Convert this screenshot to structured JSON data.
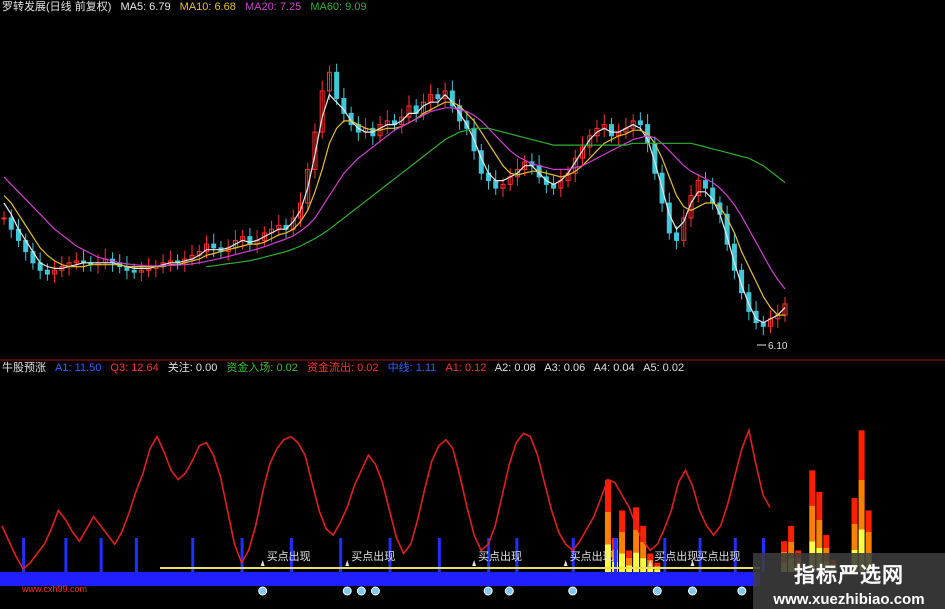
{
  "colors": {
    "background": "#000000",
    "candle_up": "#ff3030",
    "candle_down": "#40c8d8",
    "ma5": "#e8e8e8",
    "ma10": "#e8c030",
    "ma20": "#d040d0",
    "ma60": "#30b030",
    "indicator_line": "#e02020",
    "bar_bright": "#ffff40",
    "bar_mid": "#ff8000",
    "bar_deep": "#ff2000",
    "blue_band": "#2020ff",
    "signal_bar": "#2030ff",
    "yellow_line": "#e8e060",
    "arrow_label": "#e0e0e0",
    "separator": "#a01010"
  },
  "main_header": {
    "title": "罗转发展(日线 前复权)",
    "ma5": "MA5: 6.79",
    "ma10": "MA10: 6.68",
    "ma20": "MA20: 7.25",
    "ma60": "MA60: 9.09"
  },
  "indicator_header": {
    "title": "牛股预涨",
    "item1": "A1: 11.50",
    "item2": "Q3: 12.64",
    "item3": "关注: 0.00",
    "item4": "资金入场: 0.02",
    "item5": "资金流出: 0.02",
    "item6": "中线: 1.11",
    "item7": "A1: 0.12",
    "item8": "A2: 0.08",
    "item9": "A3: 0.06",
    "item10": "A4: 0.04",
    "item11": "A5: 0.02"
  },
  "low_marker": "6.10",
  "site_label": "www.cxh99.com",
  "watermark": {
    "title": "指标严选网",
    "url": "www.xuezhibiao.com"
  },
  "chart_data": [
    {
      "type": "candlestick",
      "series_names": [
        "MA5",
        "MA10",
        "MA20",
        "MA60"
      ],
      "ylim": [
        5.8,
        14.5
      ],
      "close": [
        9.2,
        8.9,
        8.6,
        8.3,
        8.0,
        7.8,
        7.7,
        7.8,
        7.9,
        8.0,
        8.05,
        8.0,
        7.95,
        8.0,
        8.1,
        8.0,
        7.9,
        7.8,
        7.75,
        7.8,
        7.85,
        7.9,
        8.0,
        8.05,
        8.0,
        8.1,
        8.2,
        8.3,
        8.5,
        8.4,
        8.3,
        8.4,
        8.6,
        8.7,
        8.5,
        8.6,
        8.8,
        8.9,
        9.0,
        8.9,
        9.2,
        9.6,
        10.5,
        11.5,
        12.6,
        13.1,
        12.4,
        12.0,
        11.7,
        11.5,
        11.6,
        11.4,
        11.7,
        11.8,
        11.7,
        11.9,
        12.2,
        12.0,
        12.3,
        12.5,
        12.4,
        12.6,
        12.2,
        11.8,
        11.6,
        11.0,
        10.4,
        10.2,
        10.0,
        10.1,
        10.3,
        10.5,
        10.7,
        10.6,
        10.3,
        10.1,
        10.0,
        10.2,
        10.4,
        10.8,
        11.1,
        11.4,
        11.6,
        11.7,
        11.4,
        11.5,
        11.6,
        11.8,
        11.7,
        11.2,
        10.4,
        9.6,
        8.8,
        8.6,
        9.2,
        9.8,
        10.2,
        10.0,
        9.6,
        9.3,
        8.5,
        7.8,
        7.2,
        6.7,
        6.4,
        6.3,
        6.5,
        6.6,
        6.9
      ],
      "ma5": [
        9.6,
        9.3,
        8.9,
        8.6,
        8.3,
        8.0,
        7.9,
        7.85,
        7.85,
        7.9,
        7.95,
        8.0,
        8.0,
        8.0,
        8.0,
        8.0,
        7.95,
        7.9,
        7.85,
        7.85,
        7.85,
        7.9,
        7.95,
        8.0,
        8.0,
        8.05,
        8.1,
        8.2,
        8.35,
        8.35,
        8.35,
        8.4,
        8.5,
        8.6,
        8.55,
        8.6,
        8.7,
        8.8,
        8.9,
        8.9,
        9.1,
        9.4,
        10.0,
        10.9,
        11.9,
        12.5,
        12.3,
        12.1,
        11.8,
        11.6,
        11.5,
        11.5,
        11.6,
        11.7,
        11.7,
        11.8,
        12.0,
        12.0,
        12.2,
        12.3,
        12.3,
        12.5,
        12.3,
        12.0,
        11.7,
        11.3,
        10.8,
        10.4,
        10.2,
        10.2,
        10.3,
        10.4,
        10.6,
        10.6,
        10.4,
        10.2,
        10.1,
        10.2,
        10.4,
        10.7,
        11.0,
        11.3,
        11.5,
        11.6,
        11.5,
        11.5,
        11.6,
        11.7,
        11.6,
        11.3,
        10.7,
        10.0,
        9.3,
        8.9,
        9.1,
        9.6,
        9.9,
        9.9,
        9.7,
        9.3,
        8.7,
        8.0,
        7.4,
        6.9,
        6.5,
        6.4,
        6.5,
        6.6,
        6.8
      ],
      "ma10": [
        9.8,
        9.6,
        9.3,
        9.0,
        8.7,
        8.4,
        8.2,
        8.05,
        7.95,
        7.9,
        7.9,
        7.9,
        7.95,
        7.95,
        7.95,
        7.95,
        7.95,
        7.9,
        7.9,
        7.9,
        7.9,
        7.9,
        7.9,
        7.95,
        7.95,
        8.0,
        8.05,
        8.1,
        8.2,
        8.25,
        8.3,
        8.35,
        8.4,
        8.45,
        8.5,
        8.5,
        8.55,
        8.65,
        8.75,
        8.8,
        8.9,
        9.1,
        9.4,
        9.9,
        10.5,
        11.2,
        11.6,
        11.8,
        11.8,
        11.7,
        11.6,
        11.55,
        11.55,
        11.6,
        11.6,
        11.65,
        11.75,
        11.85,
        12.0,
        12.1,
        12.2,
        12.3,
        12.3,
        12.2,
        12.0,
        11.8,
        11.5,
        11.2,
        10.9,
        10.6,
        10.4,
        10.35,
        10.4,
        10.45,
        10.45,
        10.4,
        10.35,
        10.3,
        10.35,
        10.45,
        10.6,
        10.8,
        11.0,
        11.2,
        11.3,
        11.4,
        11.45,
        11.55,
        11.55,
        11.45,
        11.2,
        10.8,
        10.3,
        9.8,
        9.5,
        9.4,
        9.5,
        9.6,
        9.6,
        9.5,
        9.2,
        8.8,
        8.3,
        7.9,
        7.5,
        7.1,
        6.8,
        6.6,
        6.6
      ],
      "ma20": [
        10.3,
        10.1,
        9.9,
        9.7,
        9.5,
        9.3,
        9.1,
        8.9,
        8.75,
        8.6,
        8.45,
        8.35,
        8.25,
        8.15,
        8.1,
        8.05,
        8.0,
        7.97,
        7.95,
        7.93,
        7.92,
        7.92,
        7.92,
        7.93,
        7.94,
        7.95,
        7.97,
        8.0,
        8.04,
        8.08,
        8.12,
        8.17,
        8.22,
        8.27,
        8.32,
        8.37,
        8.43,
        8.5,
        8.57,
        8.64,
        8.72,
        8.85,
        9.0,
        9.2,
        9.5,
        9.8,
        10.1,
        10.4,
        10.6,
        10.8,
        10.95,
        11.1,
        11.25,
        11.4,
        11.55,
        11.65,
        11.75,
        11.85,
        11.95,
        12.05,
        12.1,
        12.15,
        12.15,
        12.1,
        12.05,
        11.95,
        11.8,
        11.6,
        11.4,
        11.2,
        11.0,
        10.85,
        10.75,
        10.65,
        10.6,
        10.55,
        10.5,
        10.5,
        10.5,
        10.55,
        10.6,
        10.7,
        10.8,
        10.9,
        11.0,
        11.1,
        11.2,
        11.3,
        11.35,
        11.4,
        11.35,
        11.2,
        11.0,
        10.8,
        10.6,
        10.45,
        10.35,
        10.25,
        10.15,
        10.0,
        9.8,
        9.55,
        9.25,
        8.9,
        8.55,
        8.2,
        7.85,
        7.55,
        7.3
      ],
      "ma60": [
        null,
        null,
        null,
        null,
        null,
        null,
        null,
        null,
        null,
        null,
        null,
        null,
        null,
        null,
        null,
        null,
        null,
        null,
        null,
        null,
        null,
        null,
        null,
        null,
        null,
        null,
        null,
        null,
        7.9,
        7.92,
        7.95,
        7.98,
        8.0,
        8.03,
        8.06,
        8.1,
        8.15,
        8.2,
        8.25,
        8.3,
        8.37,
        8.45,
        8.55,
        8.65,
        8.77,
        8.9,
        9.05,
        9.2,
        9.35,
        9.5,
        9.65,
        9.8,
        9.95,
        10.1,
        10.25,
        10.4,
        10.55,
        10.7,
        10.85,
        11.0,
        11.15,
        11.3,
        11.4,
        11.5,
        11.55,
        11.6,
        11.6,
        11.6,
        11.55,
        11.5,
        11.45,
        11.4,
        11.35,
        11.3,
        11.25,
        11.2,
        11.15,
        11.15,
        11.15,
        11.15,
        11.15,
        11.15,
        11.15,
        11.15,
        11.15,
        11.15,
        11.15,
        11.2,
        11.2,
        11.2,
        11.2,
        11.2,
        11.2,
        11.2,
        11.2,
        11.2,
        11.15,
        11.1,
        11.05,
        11.0,
        10.95,
        10.9,
        10.85,
        10.8,
        10.7,
        10.6,
        10.45,
        10.3,
        10.15
      ],
      "annotations": [
        "6.10"
      ]
    },
    {
      "type": "line",
      "title": "牛股预涨",
      "ylim": [
        0,
        100
      ],
      "line": [
        30,
        20,
        10,
        2,
        6,
        12,
        18,
        28,
        40,
        34,
        26,
        20,
        28,
        36,
        30,
        24,
        18,
        26,
        38,
        52,
        64,
        80,
        88,
        78,
        66,
        60,
        64,
        72,
        82,
        84,
        76,
        62,
        40,
        18,
        6,
        14,
        30,
        52,
        70,
        80,
        86,
        88,
        84,
        76,
        58,
        40,
        28,
        24,
        32,
        42,
        56,
        66,
        76,
        70,
        58,
        40,
        22,
        12,
        18,
        34,
        54,
        72,
        82,
        86,
        80,
        62,
        42,
        24,
        14,
        18,
        30,
        50,
        70,
        84,
        90,
        88,
        76,
        58,
        40,
        26,
        18,
        14,
        20,
        28,
        36,
        48,
        60,
        58,
        50,
        42,
        30,
        20,
        14,
        18,
        28,
        40,
        58,
        66,
        56,
        40,
        30,
        24,
        30,
        44,
        62,
        80,
        92,
        70,
        50,
        42
      ],
      "bars": [
        0,
        0,
        0,
        0,
        0,
        0,
        0,
        0,
        0,
        0,
        0,
        0,
        0,
        0,
        0,
        0,
        0,
        0,
        0,
        0,
        0,
        0,
        0,
        0,
        0,
        0,
        0,
        0,
        0,
        0,
        0,
        0,
        0,
        0,
        0,
        0,
        0,
        0,
        0,
        0,
        0,
        0,
        0,
        0,
        0,
        0,
        0,
        0,
        0,
        0,
        0,
        0,
        0,
        0,
        0,
        0,
        0,
        0,
        0,
        0,
        0,
        0,
        0,
        0,
        0,
        0,
        0,
        0,
        0,
        0,
        0,
        0,
        0,
        0,
        0,
        0,
        0,
        0,
        0,
        0,
        0,
        0,
        0,
        0,
        0,
        0,
        60,
        22,
        40,
        14,
        42,
        30,
        12,
        6,
        0,
        0,
        0,
        0,
        0,
        0,
        0,
        0,
        0,
        0,
        0,
        0,
        0,
        0,
        0,
        0,
        0,
        20,
        30,
        14,
        0,
        66,
        52,
        24,
        8,
        0,
        0,
        48,
        92,
        40,
        0
      ],
      "signals": [
        3,
        9,
        14,
        19,
        27,
        34,
        41,
        48,
        55,
        62,
        69,
        73,
        81,
        87,
        94,
        99,
        104,
        108
      ],
      "labels": [
        {
          "index": 37,
          "text": "买点出现"
        },
        {
          "index": 49,
          "text": "买点出现"
        },
        {
          "index": 67,
          "text": "买点出现"
        },
        {
          "index": 80,
          "text": "买点出现"
        },
        {
          "index": 92,
          "text": "买点出现"
        },
        {
          "index": 98,
          "text": "买点出现"
        }
      ],
      "circles": [
        37,
        49,
        51,
        53,
        69,
        72,
        81,
        93,
        98,
        105
      ]
    }
  ]
}
